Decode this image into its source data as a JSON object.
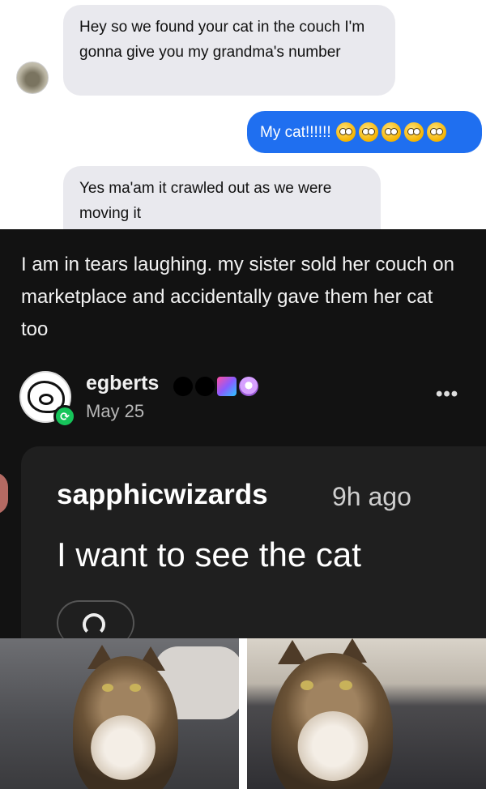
{
  "chat": {
    "message_1": "Hey so we found your cat in the couch I'm gonna give you my grandma's number",
    "message_2": "My cat!!!!!!",
    "message_2_emoji": [
      "flushed-face",
      "flushed-face",
      "flushed-face",
      "flushed-face",
      "flushed-face"
    ],
    "message_3": "Yes ma'am it crawled out as we were moving it",
    "colors": {
      "incoming": "#e9e9ee",
      "outgoing": "#1f6ff0"
    }
  },
  "post": {
    "text": "I am in tears laughing. my sister sold her couch on marketplace and accidentally gave them her cat too",
    "username": "egberts",
    "date": "May 25",
    "more_icon": "ellipsis-icon",
    "badges": [
      "black-dot",
      "black-dot",
      "rainbow-bug",
      "purple-gem"
    ]
  },
  "comment": {
    "username": "sapphicwizards",
    "time": "9h ago",
    "body": "I want to see the cat"
  },
  "photos": {
    "items": [
      "cat-photo-1",
      "cat-photo-2"
    ]
  }
}
